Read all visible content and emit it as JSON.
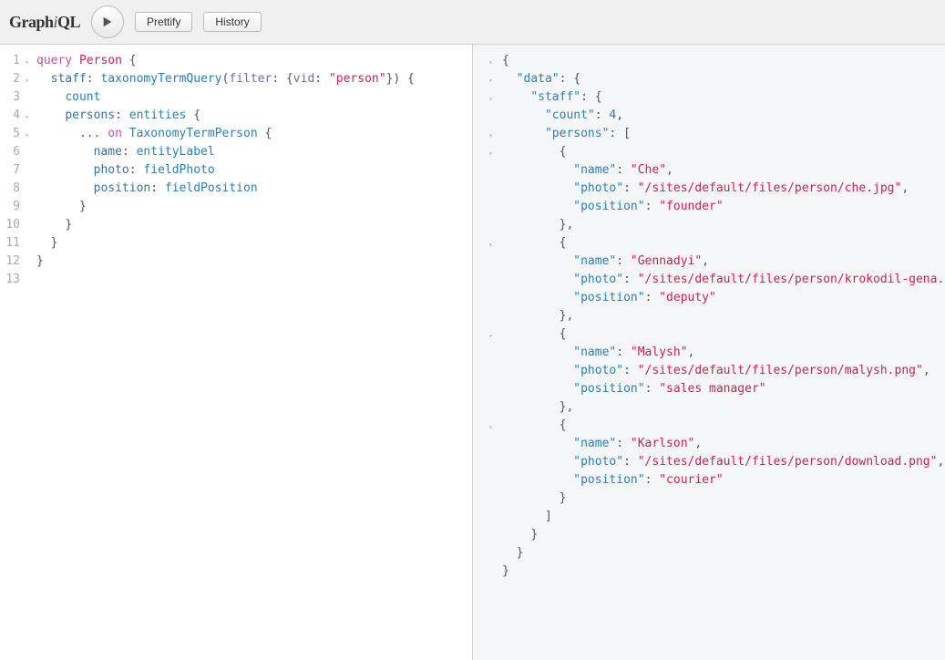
{
  "app": {
    "logo_plain_prefix": "Graph",
    "logo_italic": "i",
    "logo_plain_suffix": "QL"
  },
  "toolbar": {
    "prettify": "Prettify",
    "history": "History"
  },
  "query": {
    "lines": [
      {
        "n": 1,
        "fold": true,
        "html": "<span class='kw'>query</span> <span class='str'>Person</span> <span class='punc'>{</span>"
      },
      {
        "n": 2,
        "fold": true,
        "html": "  <span class='alias'>staff</span><span class='punc'>:</span> <span class='name'>taxonomyTermQuery</span><span class='punc'>(</span><span class='arg'>filter</span><span class='punc'>: {</span><span class='arg'>vid</span><span class='punc'>:</span> <span class='str'>\"person\"</span><span class='punc'>}) {</span>"
      },
      {
        "n": 3,
        "fold": false,
        "html": "    <span class='name'>count</span>"
      },
      {
        "n": 4,
        "fold": true,
        "html": "    <span class='alias'>persons</span><span class='punc'>:</span> <span class='name'>entities</span> <span class='punc'>{</span>"
      },
      {
        "n": 5,
        "fold": true,
        "html": "      <span class='spread'>...</span> <span class='kw'>on</span> <span class='name'>TaxonomyTermPerson</span> <span class='punc'>{</span>"
      },
      {
        "n": 6,
        "fold": false,
        "html": "        <span class='alias'>name</span><span class='punc'>:</span> <span class='name'>entityLabel</span>"
      },
      {
        "n": 7,
        "fold": false,
        "html": "        <span class='alias'>photo</span><span class='punc'>:</span> <span class='name'>fieldPhoto</span>"
      },
      {
        "n": 8,
        "fold": false,
        "html": "        <span class='alias'>position</span><span class='punc'>:</span> <span class='name'>fieldPosition</span>"
      },
      {
        "n": 9,
        "fold": false,
        "html": "      <span class='punc'>}</span>"
      },
      {
        "n": 10,
        "fold": false,
        "html": "    <span class='punc'>}</span>"
      },
      {
        "n": 11,
        "fold": false,
        "html": "  <span class='punc'>}</span>"
      },
      {
        "n": 12,
        "fold": false,
        "html": "<span class='punc'>}</span>"
      },
      {
        "n": 13,
        "fold": false,
        "html": ""
      }
    ]
  },
  "result": {
    "lines": [
      {
        "fold": true,
        "indent": 0,
        "html": "<span class='jpunc'>{</span>"
      },
      {
        "fold": true,
        "indent": 1,
        "html": "<span class='jkey'>\"data\"</span><span class='jpunc'>: {</span>"
      },
      {
        "fold": true,
        "indent": 2,
        "html": "<span class='jkey'>\"staff\"</span><span class='jpunc'>: {</span>"
      },
      {
        "fold": false,
        "indent": 3,
        "html": "<span class='jkey'>\"count\"</span><span class='jpunc'>: </span><span class='jnum'>4</span><span class='jpunc'>,</span>"
      },
      {
        "fold": true,
        "indent": 3,
        "html": "<span class='jkey'>\"persons\"</span><span class='jpunc'>: [</span>"
      },
      {
        "fold": true,
        "indent": 4,
        "html": "<span class='jpunc'>{</span>"
      },
      {
        "fold": false,
        "indent": 5,
        "html": "<span class='jkey'>\"name\"</span><span class='jpunc'>: </span><span class='jstr'>\"Che\"</span><span class='jpunc'>,</span>"
      },
      {
        "fold": false,
        "indent": 5,
        "html": "<span class='jkey'>\"photo\"</span><span class='jpunc'>: </span><span class='jstr'>\"/sites/default/files/person/che.jpg\"</span><span class='jpunc'>,</span>"
      },
      {
        "fold": false,
        "indent": 5,
        "html": "<span class='jkey'>\"position\"</span><span class='jpunc'>: </span><span class='jstr'>\"founder\"</span>"
      },
      {
        "fold": false,
        "indent": 4,
        "html": "<span class='jpunc'>},</span>"
      },
      {
        "fold": true,
        "indent": 4,
        "html": "<span class='jpunc'>{</span>"
      },
      {
        "fold": false,
        "indent": 5,
        "html": "<span class='jkey'>\"name\"</span><span class='jpunc'>: </span><span class='jstr'>\"Gennadyi\"</span><span class='jpunc'>,</span>"
      },
      {
        "fold": false,
        "indent": 5,
        "html": "<span class='jkey'>\"photo\"</span><span class='jpunc'>: </span><span class='jstr'>\"/sites/default/files/person/krokodil-gena.jpg\"</span><span class='jpunc'>,</span>"
      },
      {
        "fold": false,
        "indent": 5,
        "html": "<span class='jkey'>\"position\"</span><span class='jpunc'>: </span><span class='jstr'>\"deputy\"</span>"
      },
      {
        "fold": false,
        "indent": 4,
        "html": "<span class='jpunc'>},</span>"
      },
      {
        "fold": true,
        "indent": 4,
        "html": "<span class='jpunc'>{</span>"
      },
      {
        "fold": false,
        "indent": 5,
        "html": "<span class='jkey'>\"name\"</span><span class='jpunc'>: </span><span class='jstr'>\"Malysh\"</span><span class='jpunc'>,</span>"
      },
      {
        "fold": false,
        "indent": 5,
        "html": "<span class='jkey'>\"photo\"</span><span class='jpunc'>: </span><span class='jstr'>\"/sites/default/files/person/malysh.png\"</span><span class='jpunc'>,</span>"
      },
      {
        "fold": false,
        "indent": 5,
        "html": "<span class='jkey'>\"position\"</span><span class='jpunc'>: </span><span class='jstr'>\"sales manager\"</span>"
      },
      {
        "fold": false,
        "indent": 4,
        "html": "<span class='jpunc'>},</span>"
      },
      {
        "fold": true,
        "indent": 4,
        "html": "<span class='jpunc'>{</span>"
      },
      {
        "fold": false,
        "indent": 5,
        "html": "<span class='jkey'>\"name\"</span><span class='jpunc'>: </span><span class='jstr'>\"Karlson\"</span><span class='jpunc'>,</span>"
      },
      {
        "fold": false,
        "indent": 5,
        "html": "<span class='jkey'>\"photo\"</span><span class='jpunc'>: </span><span class='jstr'>\"/sites/default/files/person/download.png\"</span><span class='jpunc'>,</span>"
      },
      {
        "fold": false,
        "indent": 5,
        "html": "<span class='jkey'>\"position\"</span><span class='jpunc'>: </span><span class='jstr'>\"courier\"</span>"
      },
      {
        "fold": false,
        "indent": 4,
        "html": "<span class='jpunc'>}</span>"
      },
      {
        "fold": false,
        "indent": 3,
        "html": "<span class='jpunc'>]</span>"
      },
      {
        "fold": false,
        "indent": 2,
        "html": "<span class='jpunc'>}</span>"
      },
      {
        "fold": false,
        "indent": 1,
        "html": "<span class='jpunc'>}</span>"
      },
      {
        "fold": false,
        "indent": 0,
        "html": "<span class='jpunc'>}</span>"
      }
    ]
  }
}
